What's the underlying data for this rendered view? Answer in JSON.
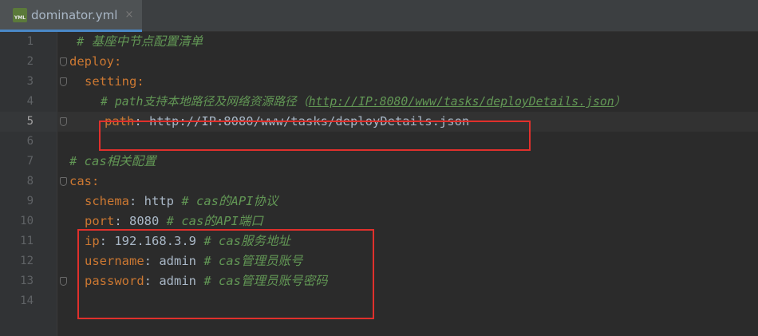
{
  "tab": {
    "filename": "dominator.yml",
    "icon": "yml-file-icon",
    "icon_text": "YML",
    "close": "×"
  },
  "lines": [
    {
      "num": "1",
      "comment": "# 基座中节点配置清单"
    },
    {
      "num": "2",
      "key": "deploy",
      "punct": ":"
    },
    {
      "num": "3",
      "key": "setting",
      "punct": ":"
    },
    {
      "num": "4",
      "comment_pre": "# path支持本地路径及网络资源路径（",
      "link": "http://IP:8080/www/tasks/deployDetails.json",
      "comment_post": "）"
    },
    {
      "num": "5",
      "key": "path",
      "value": ": http://IP:8080/www/tasks/deployDetails.json"
    },
    {
      "num": "6"
    },
    {
      "num": "7",
      "comment": "# cas相关配置"
    },
    {
      "num": "8",
      "key": "cas",
      "punct": ":"
    },
    {
      "num": "9",
      "key": "schema",
      "value": ": http ",
      "comment": "# cas的API协议"
    },
    {
      "num": "10",
      "key": "port",
      "value": ": 8080 ",
      "comment": "# cas的API端口"
    },
    {
      "num": "11",
      "key": "ip",
      "value": ": 192.168.3.9 ",
      "comment": "# cas服务地址"
    },
    {
      "num": "12",
      "key": "username",
      "value": ": admin ",
      "comment": "# cas管理员账号"
    },
    {
      "num": "13",
      "key": "password",
      "value": ": admin ",
      "comment": "# cas管理员账号密码"
    },
    {
      "num": "14"
    }
  ],
  "current_line": "5",
  "colors": {
    "background": "#2b2b2b",
    "key": "#cc7832",
    "comment": "#629755",
    "text": "#a9b7c6",
    "highlight_box": "#e0302c"
  }
}
